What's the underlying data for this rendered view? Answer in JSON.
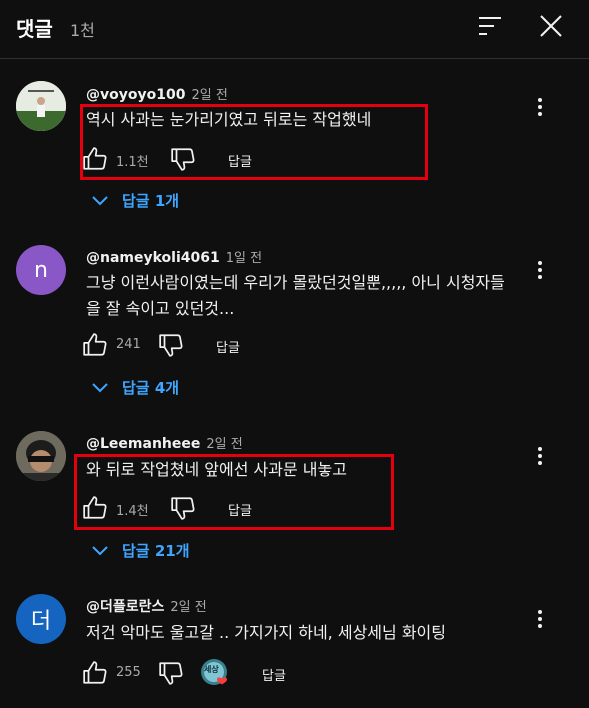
{
  "header": {
    "title": "댓글",
    "count": "1천"
  },
  "comments": [
    {
      "author": "@voyoyo100",
      "time": "2일 전",
      "text": "역시 사과는 눈가리기였고 뒤로는 작업했네",
      "likes": "1.1천",
      "reply": "답글",
      "replies": "답글 1개"
    },
    {
      "author": "@nameykoli4061",
      "time": "1일 전",
      "avatar_letter": "n",
      "avatar_color": "#8a57c7",
      "text": "그냥 이런사람이였는데 우리가 몰랐던것일뿐,,,,, 아니 시청자들을 잘 속이고 있던것...",
      "likes": "241",
      "reply": "답글",
      "replies": "답글 4개"
    },
    {
      "author": "@Leemanheee",
      "time": "2일 전",
      "text": "와 뒤로 작업쳤네 앞에선 사과문 내놓고",
      "likes": "1.4천",
      "reply": "답글",
      "replies": "답글 21개"
    },
    {
      "author": "@더플로란스",
      "time": "2일 전",
      "avatar_letter": "더",
      "avatar_color": "#1565c0",
      "text": "저건 악마도 울고갈 .. 가지가지 하네, 세상세님 화이팅",
      "likes": "255",
      "reply": "답글",
      "creator_badge": "세상"
    }
  ],
  "colors": {
    "highlight": "#e5000f",
    "link": "#3ea6ff"
  }
}
